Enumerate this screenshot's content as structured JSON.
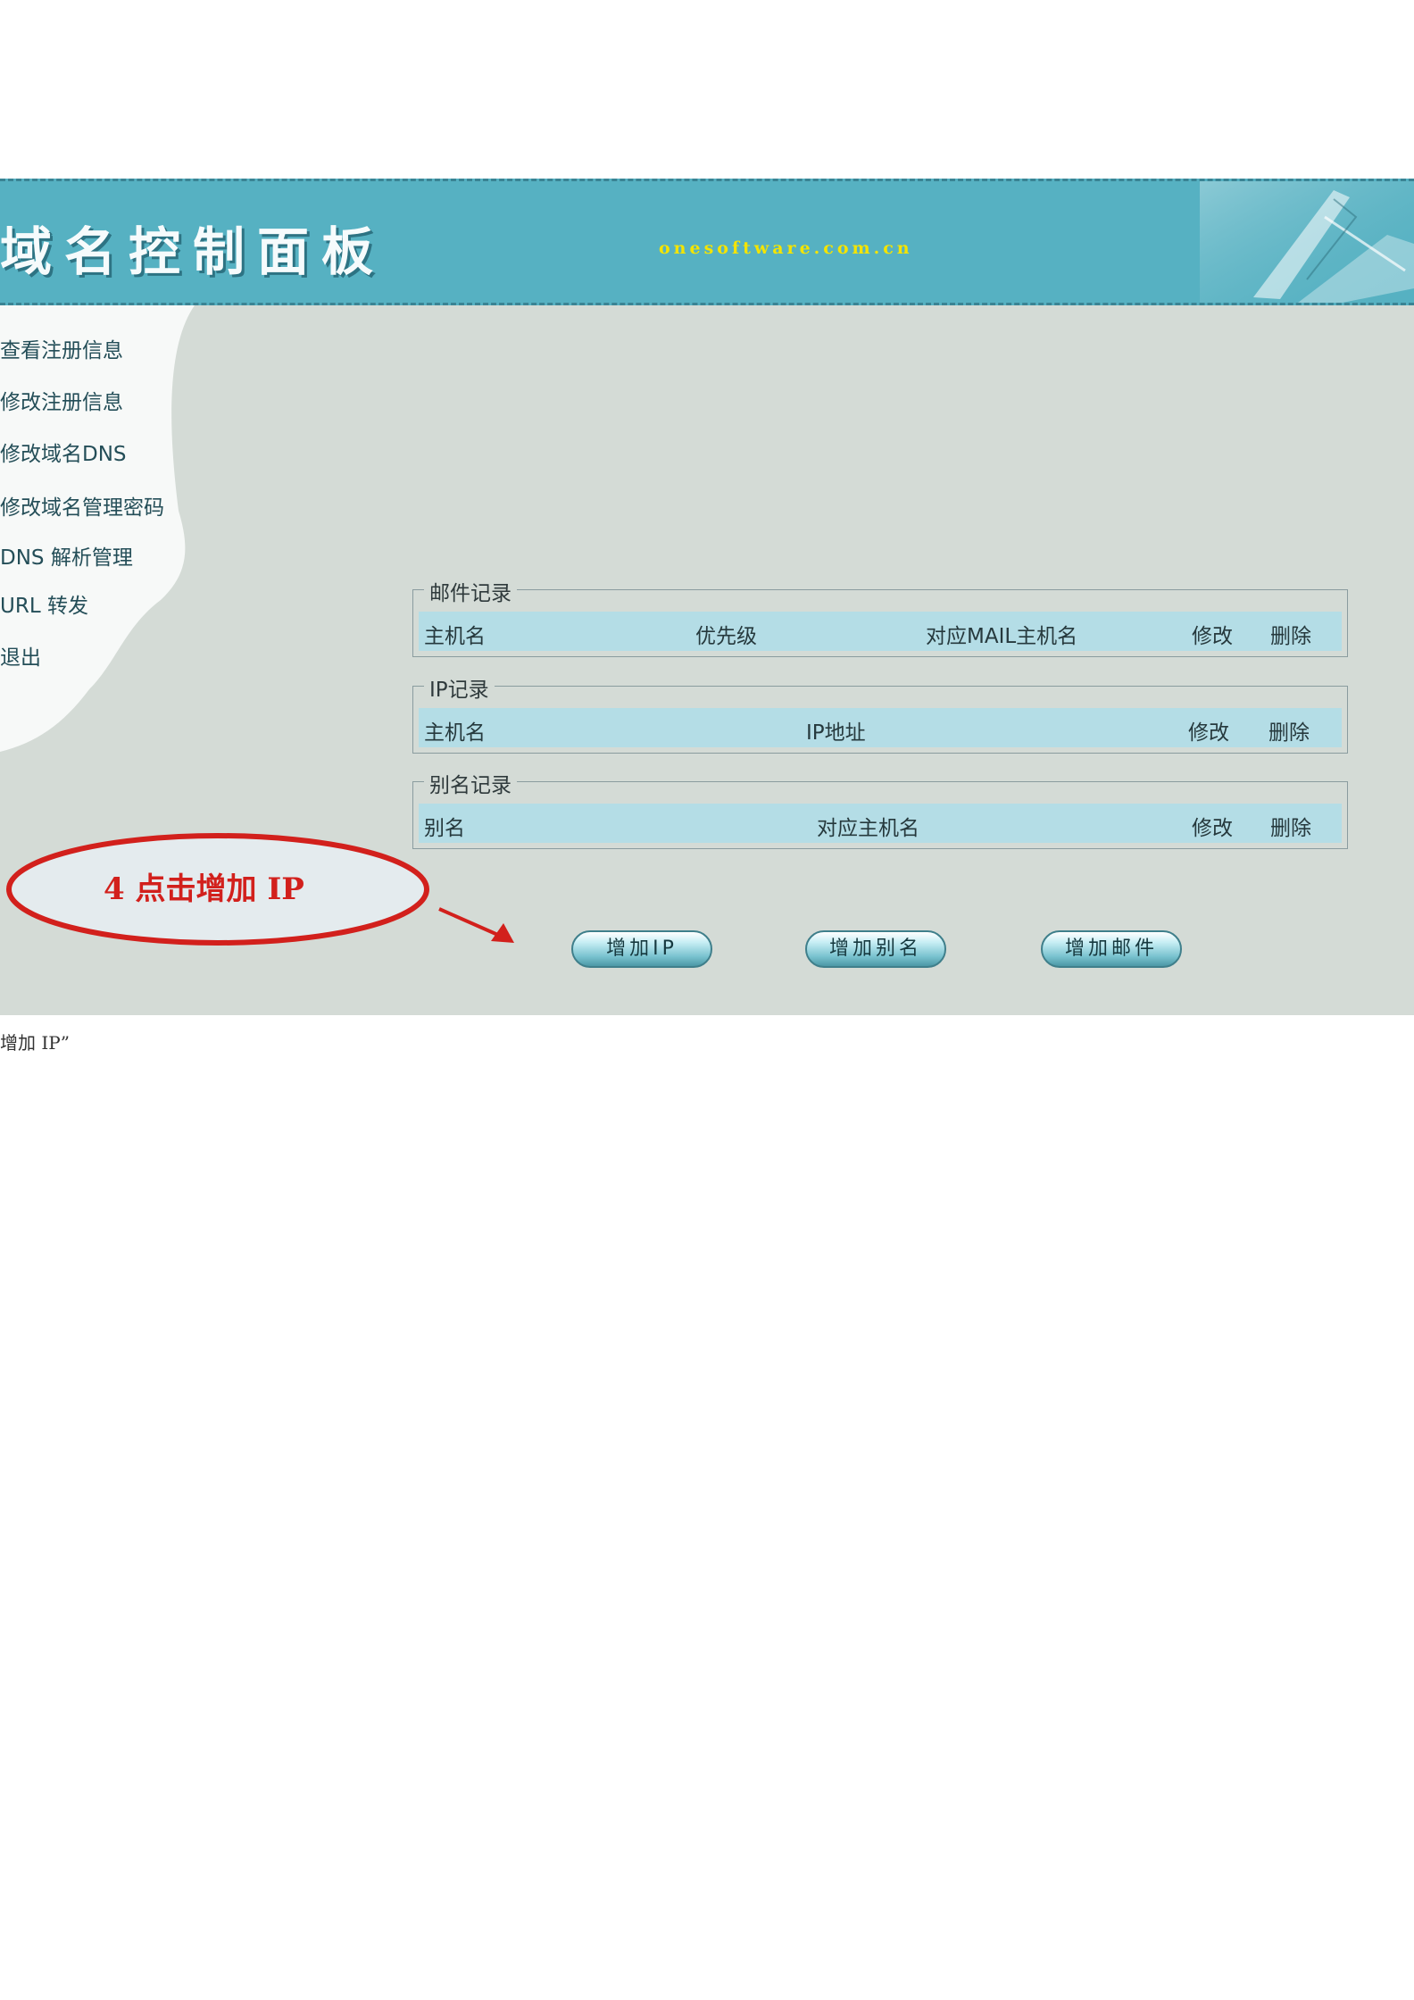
{
  "header": {
    "title": "域名控制面板",
    "url": "onesoftware.com.cn"
  },
  "menu": [
    "查看注册信息",
    "修改注册信息",
    "修改域名DNS",
    "修改域名管理密码",
    "DNS 解析管理",
    "URL 转发",
    "退出"
  ],
  "records": {
    "mail": {
      "legend": "邮件记录",
      "cols": [
        "主机名",
        "优先级",
        "对应MAIL主机名",
        "修改",
        "删除"
      ]
    },
    "ip": {
      "legend": "IP记录",
      "cols": [
        "主机名",
        "IP地址",
        "修改",
        "删除"
      ]
    },
    "alias": {
      "legend": "别名记录",
      "cols": [
        "别名",
        "对应主机名",
        "修改",
        "删除"
      ]
    }
  },
  "buttons": {
    "add_ip": "增加IP",
    "add_alias": "增加别名",
    "add_mail": "增加邮件"
  },
  "annotation": {
    "text": "4 点击增加 IP"
  },
  "caption": "增加 IP”",
  "colors": {
    "header_bg": "#56b1c2",
    "panel_bg": "#d4dbd6",
    "row_bg": "#b4dde6",
    "annotation": "#d2201c",
    "url": "#f4e400"
  }
}
